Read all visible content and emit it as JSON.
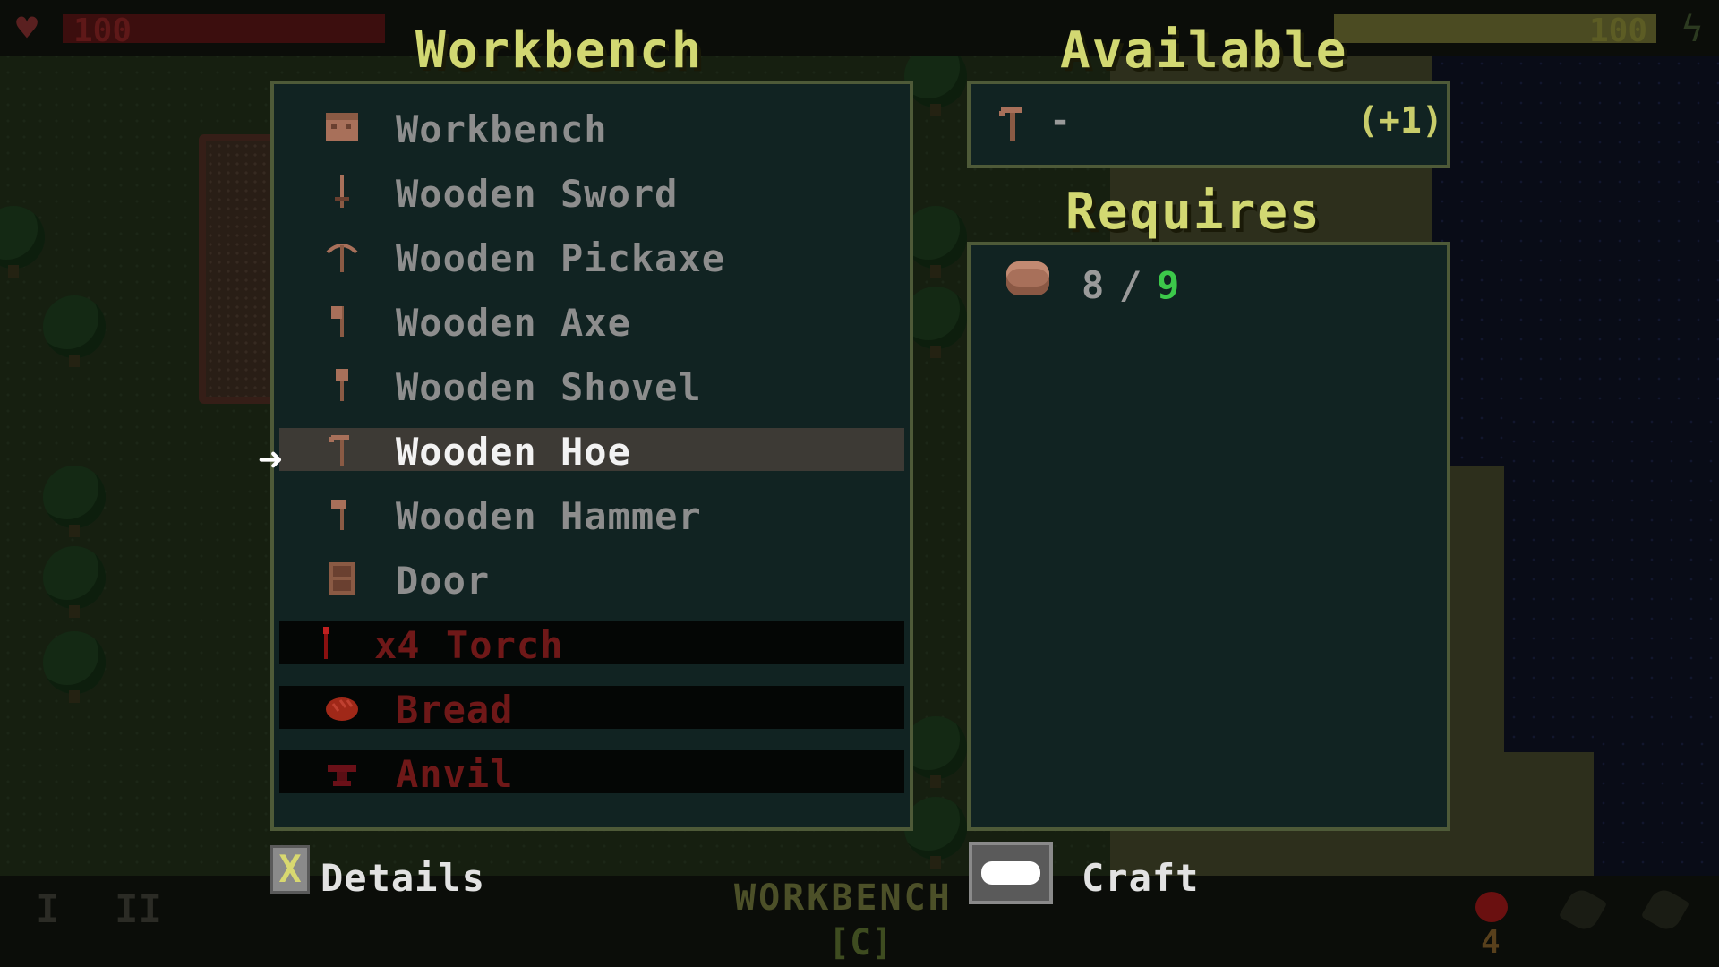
{
  "hud": {
    "health": "100",
    "health_fraction": 1.0,
    "stamina": "100",
    "stamina_fraction": 1.0,
    "hotbar_slot_1": "I",
    "hotbar_slot_2": "II",
    "station_name": "WORKBENCH",
    "station_key": "[C]",
    "food_count": "4",
    "icons": [
      "heart-icon",
      "lightning-bolt-icon",
      "apple-icon"
    ]
  },
  "titles": {
    "workbench": "Workbench",
    "available": "Available",
    "requires": "Requires"
  },
  "recipes": [
    {
      "label": "Workbench",
      "icon": "workbench-icon",
      "state": "normal"
    },
    {
      "label": "Wooden Sword",
      "icon": "sword-icon",
      "state": "normal"
    },
    {
      "label": "Wooden Pickaxe",
      "icon": "pickaxe-icon",
      "state": "normal"
    },
    {
      "label": "Wooden Axe",
      "icon": "axe-icon",
      "state": "normal"
    },
    {
      "label": "Wooden Shovel",
      "icon": "shovel-icon",
      "state": "normal"
    },
    {
      "label": "Wooden Hoe",
      "icon": "hoe-icon",
      "state": "selected"
    },
    {
      "label": "Wooden Hammer",
      "icon": "hammer-icon",
      "state": "normal"
    },
    {
      "label": "Door",
      "icon": "door-icon",
      "state": "normal"
    },
    {
      "qty": "x4",
      "label": "Torch",
      "icon": "torch-icon",
      "state": "locked"
    },
    {
      "label": "Bread",
      "icon": "bread-icon",
      "state": "locked"
    },
    {
      "label": "Anvil",
      "icon": "anvil-icon",
      "state": "locked"
    }
  ],
  "available": {
    "icon": "hoe-icon",
    "count": "-",
    "bonus": "(+1)"
  },
  "requires": [
    {
      "icon": "plank-icon",
      "have": "8",
      "separator": "/",
      "need": "9"
    }
  ],
  "controls": {
    "details_key": "X",
    "details_label": "Details",
    "craft_key": "space-key",
    "craft_label": "Craft"
  },
  "colors": {
    "title": "#d2d872",
    "panel_bg": "#112322",
    "panel_border": "#4e5a38",
    "selected_row": "#3d3a35",
    "locked_text": "#6f1818",
    "requirement_met": "#3cc84a"
  }
}
